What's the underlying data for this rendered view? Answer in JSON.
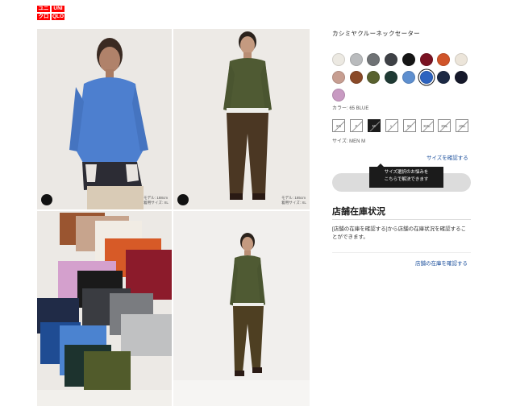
{
  "logo": {
    "cells": [
      "ユニ",
      "UNI",
      "クロ",
      "QLO"
    ]
  },
  "gallery": {
    "photo1_caption": [
      "モデル: 188cm",
      "着用サイズ: XL"
    ],
    "photo2_caption": [
      "モデル: 185cm",
      "着用サイズ: XL"
    ]
  },
  "product": {
    "name": "カシミヤクルーネックセーター",
    "color_label": "カラー: 65 BLUE",
    "size_label": "サイズ: MEN M",
    "size_guide_link": "サイズを確認する"
  },
  "swatches": [
    {
      "name": "off-white",
      "color": "#ece9e2"
    },
    {
      "name": "light-gray",
      "color": "#b9bbbd"
    },
    {
      "name": "gray",
      "color": "#6f7275"
    },
    {
      "name": "dark-gray",
      "color": "#3e4146"
    },
    {
      "name": "black",
      "color": "#151515"
    },
    {
      "name": "wine",
      "color": "#7a1222"
    },
    {
      "name": "orange",
      "color": "#d0542a"
    },
    {
      "name": "natural",
      "color": "#ece5da"
    },
    {
      "name": "pink-beige",
      "color": "#c79e91"
    },
    {
      "name": "brown",
      "color": "#8a4a28"
    },
    {
      "name": "olive",
      "color": "#59612f"
    },
    {
      "name": "dark-green",
      "color": "#1f3a34"
    },
    {
      "name": "light-blue",
      "color": "#5e8fcf"
    },
    {
      "name": "blue",
      "color": "#2d63c0",
      "selected": true
    },
    {
      "name": "navy",
      "color": "#1c2944"
    },
    {
      "name": "dark-navy",
      "color": "#15182a"
    },
    {
      "name": "lilac",
      "color": "#c89ac2"
    }
  ],
  "sizes": [
    {
      "label": "XS",
      "selected": false
    },
    {
      "label": "S",
      "selected": false
    },
    {
      "label": "M",
      "selected": true
    },
    {
      "label": "L",
      "selected": false
    },
    {
      "label": "XL",
      "selected": false
    },
    {
      "label": "XXL",
      "selected": false
    },
    {
      "label": "3XL",
      "selected": false
    },
    {
      "label": "4XL",
      "selected": false
    }
  ],
  "tooltip": {
    "line1": "サイズ選択のお悩みを",
    "line2": "こちらで解決できます"
  },
  "stock": {
    "title": "店舗在庫状況",
    "description": "[店舗の在庫を確認する]から店舗の在庫状況を確認することができます。",
    "link": "店舗の在庫を確認する"
  }
}
